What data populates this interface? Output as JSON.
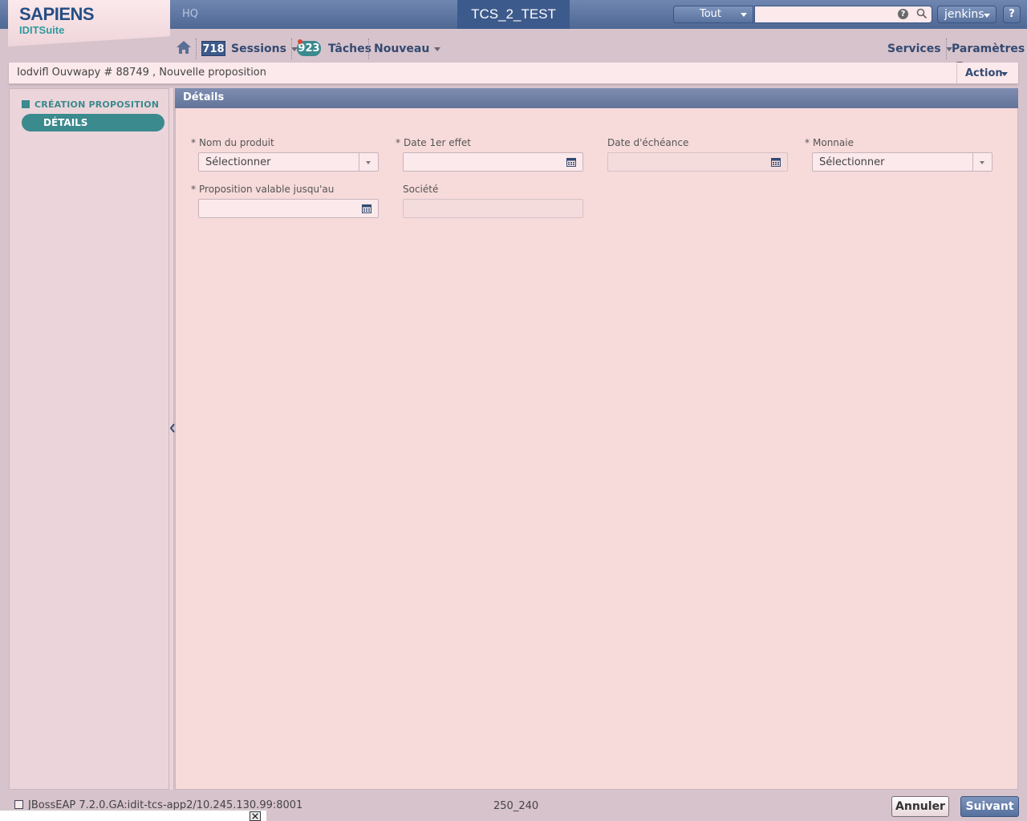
{
  "header": {
    "logo_main": "SAPIENS",
    "logo_sub": "IDITSuite",
    "location": "HQ",
    "environment": "TCS_2_TEST",
    "search_scope": "Tout",
    "search_placeholder": "",
    "user": "jenkins",
    "help_label": "?"
  },
  "nav": {
    "sessions_count": "718",
    "sessions_label": "Sessions",
    "tasks_count": "923",
    "tasks_label": "Tâches",
    "new_label": "Nouveau",
    "services_label": "Services",
    "settings_label": "Paramètres"
  },
  "breadcrumb": {
    "text": "Iodvifl Ouvwapy # 88749 , Nouvelle proposition",
    "action_label": "Action"
  },
  "sidebar": {
    "section": "CRÉATION PROPOSITION",
    "items": [
      {
        "label": "DÉTAILS",
        "active": true
      }
    ]
  },
  "panel": {
    "title": "Détails",
    "fields": {
      "product": {
        "label": "Nom du produit",
        "required": "*",
        "value": "Sélectionner"
      },
      "effective_date": {
        "label": "Date 1er effet",
        "required": "*",
        "value": ""
      },
      "due_date": {
        "label": "Date d'échéance",
        "value": ""
      },
      "currency": {
        "label": "Monnaie",
        "required": "*",
        "value": "Sélectionner"
      },
      "valid_until": {
        "label": "Proposition valable jusqu'au",
        "required": "*",
        "value": ""
      },
      "company": {
        "label": "Société",
        "value": ""
      }
    }
  },
  "footer": {
    "info": "JBossEAP 7.2.0.GA:idit-tcs-app2/10.245.130.99:8001",
    "mid": "250_240",
    "cancel_label": "Annuler",
    "next_label": "Suivant"
  },
  "colors": {
    "accent_teal": "#3a8a8e",
    "header_blue": "#4f6894",
    "panel_bg": "#f7dada"
  }
}
